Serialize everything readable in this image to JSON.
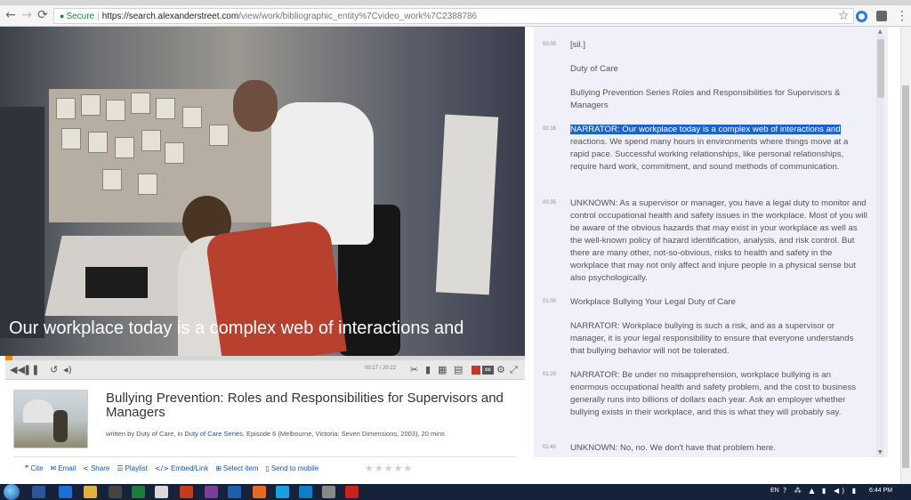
{
  "browser": {
    "secure_label": "Secure",
    "url_host": "https://search.alexanderstreet.com",
    "url_path": "/view/work/bibliographic_entity%7Cvideo_work%7C2388786",
    "back_glyph": "←",
    "forward_glyph": "→",
    "reload_glyph": "⟳",
    "star_glyph": "☆",
    "menu_glyph": "⋮"
  },
  "video": {
    "caption": "Our workplace today is a complex web of interactions and",
    "time": "00:17 / 20:22",
    "progress": 0.014,
    "cc_label": "cc"
  },
  "work": {
    "title": "Bullying Prevention: Roles and Responsibilities for Supervisors and Managers",
    "byline_prefix": "written by Duty of Care, in ",
    "series_link": "Duty of Care Series",
    "byline_suffix": ", Episode 6 (Melbourne, Victoria: Seven Dimensions, 2003), 20 mins"
  },
  "actions": [
    {
      "label": "Cite",
      "icon": "quote-icon",
      "glyph": "❞"
    },
    {
      "label": "Email",
      "icon": "envelope-icon",
      "glyph": "✉"
    },
    {
      "label": "Share",
      "icon": "share-icon",
      "glyph": "<"
    },
    {
      "label": "Playlist",
      "icon": "playlist-icon",
      "glyph": "☰"
    },
    {
      "label": "Embed/Link",
      "icon": "code-icon",
      "glyph": "</>"
    },
    {
      "label": "Select item",
      "icon": "plus-box-icon",
      "glyph": "⊞"
    },
    {
      "label": "Send to mobile",
      "icon": "mobile-icon",
      "glyph": "▯"
    }
  ],
  "rating": {
    "stars": "★★★★★"
  },
  "transcript": {
    "entries": [
      {
        "time": "00:00",
        "text": "[sil.]"
      },
      {
        "time": "",
        "text": "Duty of Care"
      },
      {
        "time": "",
        "text": "Bullying Prevention Series Roles and Responsibilities for Supervisors & Managers"
      },
      {
        "time": "00:16",
        "speaker": "NARRATOR:",
        "highlight": "Our workplace today is a complex web of interactions and",
        "text": "reactions. We spend many hours in environments where things move at a rapid pace. Successful working relationships, like personal relationships, require hard work, commitment, and sound methods of communication."
      },
      {
        "time": "00:35",
        "text": "UNKNOWN: As a supervisor or manager, you have a legal duty to monitor and control occupational health and safety issues in the workplace. Most of you will be aware of the obvious hazards that may exist in your workplace as well as the well-known policy of hazard identification, analysis, and risk control. But there are many other, not-so-obvious, risks to health and safety in the workplace that may not only affect and injure people in a physical sense but also psychologically."
      },
      {
        "time": "01:00",
        "text": "Workplace Bullying Your Legal Duty of Care"
      },
      {
        "time": "",
        "text": "NARRATOR: Workplace bullying is such a risk, and as a supervisor or manager, it is your legal responsibility to ensure that everyone understands that bullying behavior will not be tolerated."
      },
      {
        "time": "01:20",
        "text": "NARRATOR: Be under no misapprehension, workplace bullying is an enormous occupational health and safety problem, and the cost to business generally runs into billions of dollars each year. Ask an employer whether bullying exists in their workplace, and this is what they will probably say."
      },
      {
        "time": "01:40",
        "text": "UNKNOWN: No, no. We don't have that problem here."
      }
    ]
  },
  "taskbar": {
    "lang": "EN",
    "tray": "? ⁂ ▲ ▮ ◀) ▮",
    "clock": "6:44 PM"
  }
}
